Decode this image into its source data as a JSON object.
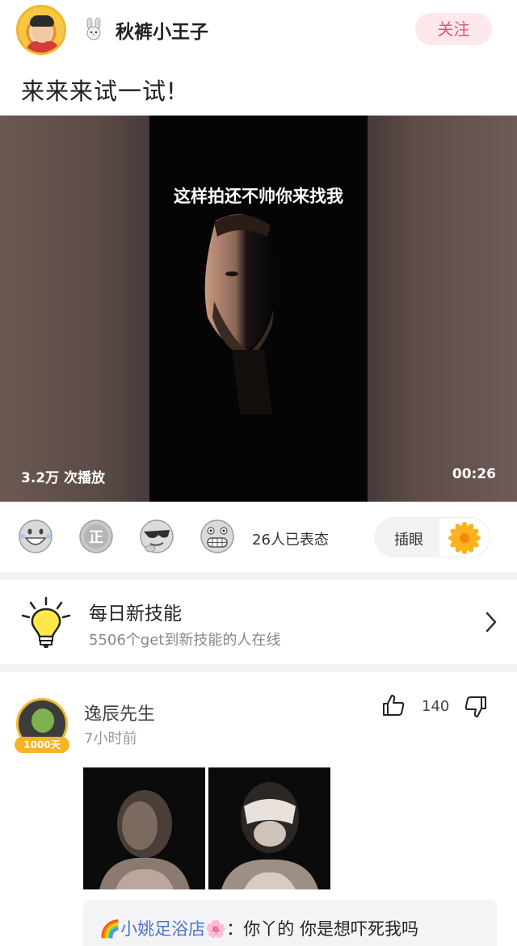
{
  "header": {
    "username": "秋裤小王子",
    "follow_label": "关注"
  },
  "post": {
    "title": "来来来试一试!"
  },
  "video": {
    "caption": "这样拍还不帅你来找我",
    "play_count": "3.2万 次播放",
    "duration": "00:26"
  },
  "reactions": {
    "emojis": [
      "grinning-face-icon",
      "zheng-badge-icon",
      "cool-sunglasses-face-icon",
      "grimacing-face-icon"
    ],
    "count_text": "26人已表态",
    "insert_label": "插眼"
  },
  "skill": {
    "title": "每日新技能",
    "subtitle": "5506个get到新技能的人在线"
  },
  "comment": {
    "author": "逸辰先生",
    "time": "7小时前",
    "badge": "1000天",
    "likes": "140",
    "reply": {
      "name": "🌈小姚足浴店🌸",
      "separator": "：",
      "text": "你丫的 你是想吓死我吗"
    }
  },
  "colors": {
    "follow_bg": "#fde8ec",
    "follow_text": "#f0506e",
    "reply_name": "#4a76c9",
    "badge_gold": "#f4b424"
  }
}
